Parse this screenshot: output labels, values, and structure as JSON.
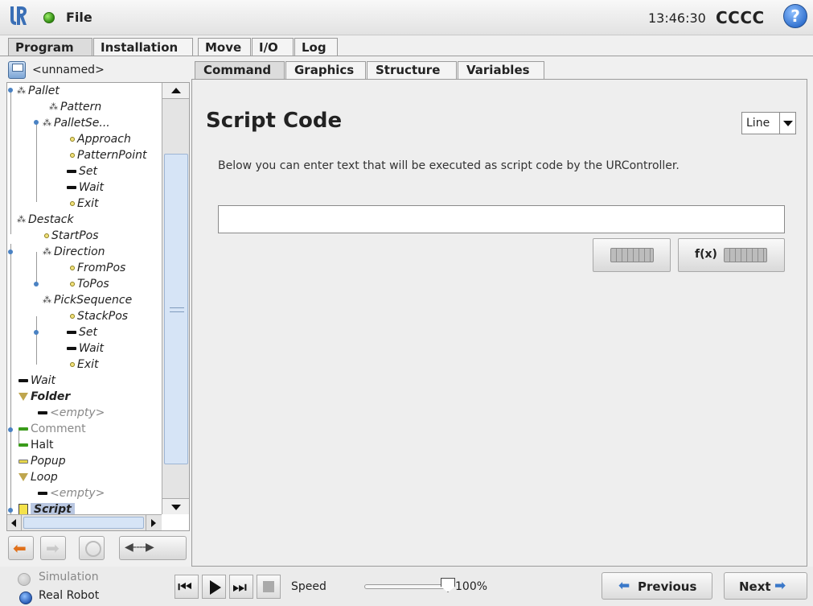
{
  "header": {
    "file_label": "File",
    "clock": "13:46:30",
    "robot_name": "CCCC",
    "help_label": "?"
  },
  "main_tabs": [
    "Program",
    "Installation",
    "Move",
    "I/O",
    "Log"
  ],
  "program": {
    "name": "<unnamed>",
    "tree": [
      {
        "label": "Pallet"
      },
      {
        "label": "Pattern"
      },
      {
        "label": "PalletSe..."
      },
      {
        "label": "Approach"
      },
      {
        "label": "PatternPoint"
      },
      {
        "label": "Set"
      },
      {
        "label": "Wait"
      },
      {
        "label": "Exit"
      },
      {
        "label": "Destack"
      },
      {
        "label": "StartPos"
      },
      {
        "label": "Direction"
      },
      {
        "label": "FromPos"
      },
      {
        "label": "ToPos"
      },
      {
        "label": "PickSequence"
      },
      {
        "label": "StackPos"
      },
      {
        "label": "Set"
      },
      {
        "label": "Wait"
      },
      {
        "label": "Exit"
      },
      {
        "label": "Wait"
      },
      {
        "label": "Folder"
      },
      {
        "label": "<empty>"
      },
      {
        "label": "Comment"
      },
      {
        "label": "Halt"
      },
      {
        "label": "Popup"
      },
      {
        "label": "Loop"
      },
      {
        "label": "<empty>"
      },
      {
        "label": "Script"
      }
    ]
  },
  "sub_tabs": [
    "Command",
    "Graphics",
    "Structure",
    "Variables"
  ],
  "command": {
    "title": "Script Code",
    "mode_value": "Line",
    "description": "Below you can enter text that will be executed as script code by the URController.",
    "script_value": "",
    "fx_label": "f(x)"
  },
  "footer": {
    "simulation_label": "Simulation",
    "real_robot_label": "Real Robot",
    "speed_label": "Speed",
    "speed_value": "100%",
    "speed_fraction": 1.0,
    "previous_label": "Previous",
    "next_label": "Next"
  },
  "colors": {
    "accent_blue": "#3a78c9",
    "status_green": "#2f8a10",
    "selection": "#b9c7e1"
  }
}
